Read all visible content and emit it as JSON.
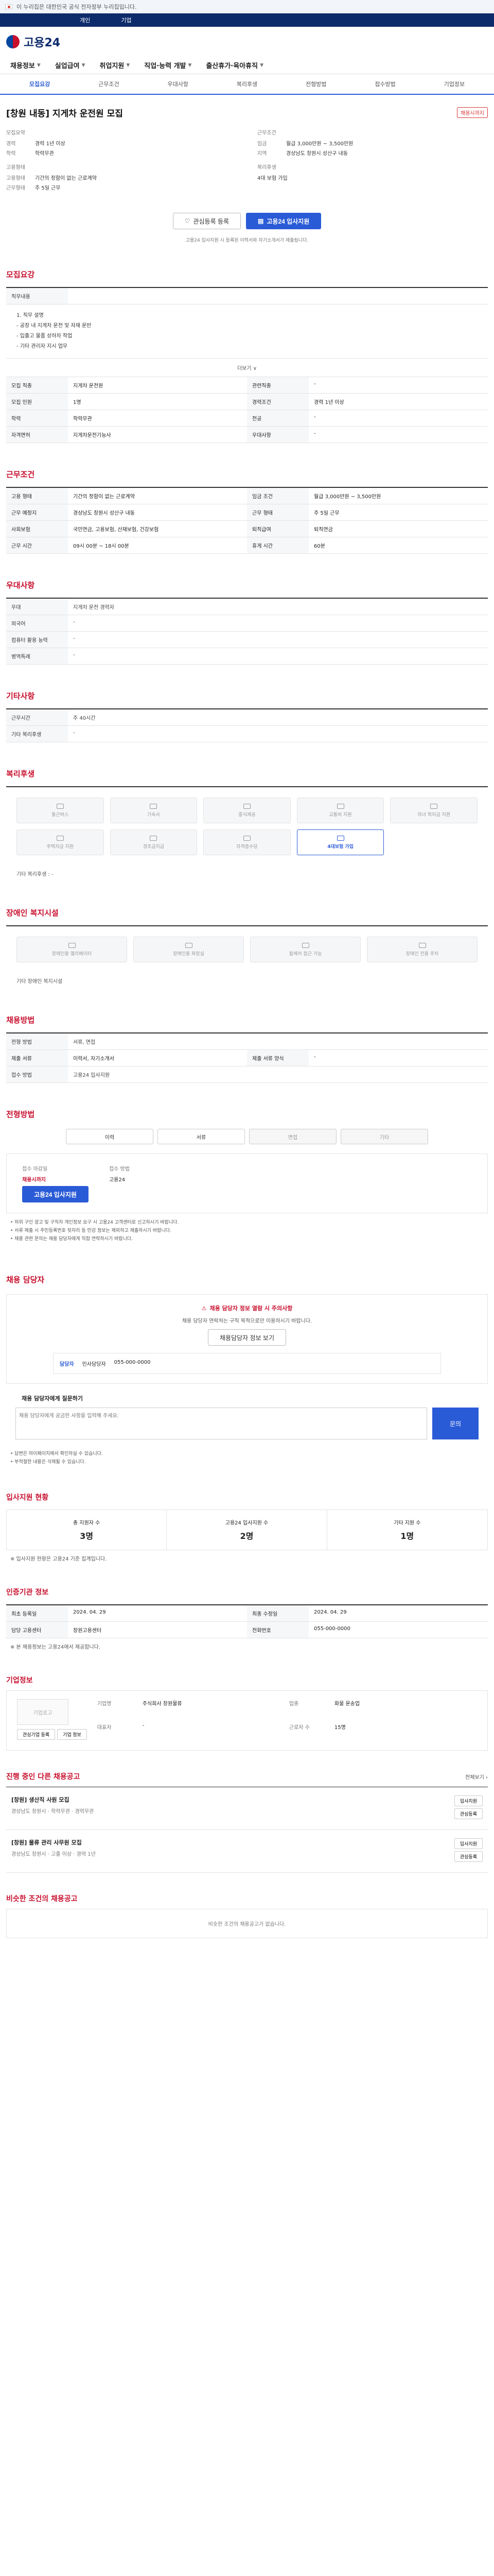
{
  "gov_bar": {
    "text": "이 누리집은 대한민국 공식 전자정부 누리집입니다."
  },
  "top_links": {
    "left": "개인",
    "middle": "기업"
  },
  "header": {
    "logo": "고용24"
  },
  "gnb": [
    "채용정보",
    "실업급여",
    "취업지원",
    "직업·능력 개발",
    "출산휴가·육아휴직"
  ],
  "sub_nav": [
    "모집요강",
    "근무조건",
    "우대사항",
    "복리후생",
    "전형방법",
    "접수방법",
    "기업정보"
  ],
  "job": {
    "title": "[창원 내동] 지게차 운전원 모집",
    "badge": "채용시까지",
    "recruit_label": "모집요약",
    "recruit": [
      {
        "k": "경력",
        "v": "경력 1년 이상"
      },
      {
        "k": "학력",
        "v": "학력무관"
      }
    ],
    "cond_label": "근무조건",
    "cond": [
      {
        "k": "임금",
        "v": "월급 3,000만원 ~ 3,500만원"
      },
      {
        "k": "지역",
        "v": "경상남도 창원시 성산구 내동"
      }
    ],
    "employ_label": "고용형태",
    "employ": [
      {
        "k": "고용형태",
        "v": "기간의 정함이 없는 근로계약"
      },
      {
        "k": "근무형태",
        "v": "주 5일 근무"
      }
    ],
    "benefit_label": "복리후생",
    "benefit": [
      {
        "k": "",
        "v": "4대 보험 가입"
      }
    ]
  },
  "buttons": {
    "interest": "관심등록 등록",
    "apply": "고용24 입사지원"
  },
  "notice": "고용24 입사지원 시 등록된 이력서와 자기소개서가 제출됩니다.",
  "sections": {
    "recruit": "모집요강",
    "work": "근무조건",
    "prefer": "우대사항",
    "etc": "기타사항",
    "welfare": "복리후생",
    "disability": "장애인 복지시설",
    "hire": "채용방법",
    "method": "전형방법",
    "contact": "채용 담당자",
    "status": "입사지원 현황",
    "jobinfo": "인증기관 정보",
    "company": "기업정보",
    "other_jobs": "진행 중인 다른 채용공고",
    "similar": "비슷한 조건의 채용공고"
  },
  "recruit": {
    "duty_title": "직무내용",
    "duty": [
      "1. 직무 설명",
      "- 공장 내 지게차 운전 및 자재 운반",
      "- 입출고 물품 상하차 작업",
      "- 기타 관리자 지시 업무"
    ],
    "more": "더보기 ∨",
    "rows": [
      [
        "모집 직종",
        "지게차 운전원",
        "관련직종",
        "-"
      ],
      [
        "모집 인원",
        "1명",
        "경력조건",
        "경력 1년 이상"
      ],
      [
        "학력",
        "학력무관",
        "전공",
        "-"
      ],
      [
        "자격면허",
        "지게차운전기능사",
        "우대사항",
        "-"
      ]
    ]
  },
  "work": {
    "rows": [
      [
        "고용 형태",
        "기간의 정함이 없는 근로계약",
        "임금 조건",
        "월급 3,000만원 ~ 3,500만원"
      ],
      [
        "근무 예정지",
        "경상남도 창원시 성산구 내동",
        "근무 형태",
        "주 5일 근무"
      ],
      [
        "사회보험",
        "국민연금, 고용보험, 산재보험, 건강보험",
        "퇴직급여",
        "퇴직연금"
      ],
      [
        "근무 시간",
        "09시 00분 ~ 18시 00분",
        "휴게 시간",
        "60분"
      ]
    ]
  },
  "prefer": {
    "rows": [
      [
        "우대",
        "지게차 운전 경력자"
      ],
      [
        "외국어",
        "-"
      ],
      [
        "컴퓨터 활용 능력",
        "-"
      ],
      [
        "병역특례",
        "-"
      ]
    ]
  },
  "etc": {
    "rows": [
      [
        "근무시간",
        "주 40시간"
      ],
      [
        "기타 복리후생",
        "-"
      ]
    ]
  },
  "welfare": {
    "items": [
      "통근버스",
      "기숙사",
      "중식제공",
      "교통비 지원",
      "자녀 학자금 지원",
      "주택자금 지원",
      "경조금지급",
      "자격증수당",
      "4대보험 가입"
    ],
    "on_index": 8,
    "note": "기타 복리후생 : -"
  },
  "disability": {
    "items": [
      "장애인용 엘리베이터",
      "장애인용 화장실",
      "휠체어 접근 가능",
      "장애인 전용 주차"
    ],
    "note": "기타 장애인 복지시설"
  },
  "hire": {
    "rows": [
      [
        "전형 방법",
        "서류, 면접"
      ],
      [
        "제출 서류",
        "이력서, 자기소개서",
        "제출 서류 양식",
        "-"
      ],
      [
        "접수 방법",
        "고용24 입사지원"
      ]
    ]
  },
  "method": {
    "tabs": [
      "이력",
      "서류",
      "면접",
      "기타"
    ],
    "apply_label": "접수 마감일",
    "apply_value": "채용시까지",
    "apply_btn": "고용24 입사지원",
    "method_label": "접수 방법",
    "method_value": "고용24",
    "bullets": [
      "• 허위 구인 광고 및 구직자 개인정보 요구 시 고용24 고객센터로 신고하시기 바랍니다.",
      "• 서류 제출 시 주민등록번호 뒷자리 등 민감 정보는 제외하고 제출하시기 바랍니다.",
      "• 채용 관련 문의는 채용 담당자에게 직접 연락하시기 바랍니다."
    ]
  },
  "contact": {
    "warn": "채용 담당자 정보 열람 시 주의사항",
    "desc": "채용 담당자 연락처는 구직 목적으로만 이용하시기 바랍니다.",
    "btn": "채용담당자 정보 보기",
    "card_title": "담당자",
    "card_name": "인사담당자",
    "card_phone": "055-000-0000",
    "inquiry_title": "채용 담당자에게 질문하기",
    "inquiry_placeholder": "채용 담당자에게 궁금한 사항을 입력해 주세요.",
    "inquiry_btn": "문의",
    "inquiry_notes": [
      "• 답변은 마이페이지에서 확인하실 수 있습니다.",
      "• 부적절한 내용은 삭제될 수 있습니다."
    ]
  },
  "status": {
    "items": [
      {
        "k": "총 지원자 수",
        "v": "3명"
      },
      {
        "k": "고용24 입사지원 수",
        "v": "2명"
      },
      {
        "k": "기타 지원 수",
        "v": "1명"
      }
    ],
    "note": "※ 입사지원 현황은 고용24 기준 집계입니다."
  },
  "jobinfo": {
    "rows": [
      [
        "최초 등록일",
        "2024. 04. 29",
        "최종 수정일",
        "2024. 04. 29"
      ],
      [
        "담당 고용센터",
        "창원고용센터",
        "전화번호",
        "055-000-0000"
      ]
    ],
    "note": "※ 본 채용정보는 고용24에서 제공합니다."
  },
  "company": {
    "logo": "기업로고",
    "rows": [
      [
        "기업명",
        "주식회사 창원물류"
      ],
      [
        "업종",
        "화물 운송업"
      ],
      [
        "대표자",
        "-"
      ],
      [
        "근로자 수",
        "15명"
      ]
    ],
    "btns": [
      "관심기업 등록",
      "기업 정보"
    ]
  },
  "other_jobs": {
    "more": "전체보기 ›",
    "items": [
      {
        "title": "[창원] 생산직 사원 모집",
        "meta": "경상남도 창원시 · 학력무관 · 경력무관",
        "btns": [
          "입사지원",
          "관심등록"
        ]
      },
      {
        "title": "[창원] 물류 관리 사무원 모집",
        "meta": "경상남도 창원시 · 고졸 이상 · 경력 1년",
        "btns": [
          "입사지원",
          "관심등록"
        ]
      }
    ]
  },
  "similar": {
    "empty": "비슷한 조건의 채용공고가 없습니다."
  }
}
